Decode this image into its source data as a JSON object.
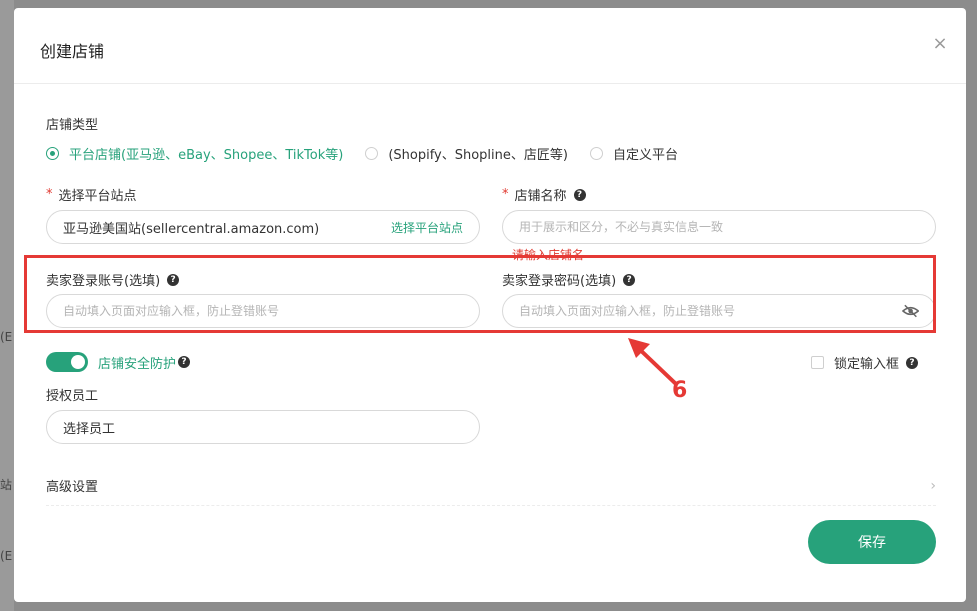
{
  "background": {
    "frag1": "(E",
    "frag2": "站",
    "frag3": "(E"
  },
  "modal": {
    "title": "创建店铺",
    "close": "×"
  },
  "store_type": {
    "label": "店铺类型",
    "options": [
      {
        "label": "平台店铺(亚马逊、eBay、Shopee、TikTok等)",
        "checked": true
      },
      {
        "label": "(Shopify、Shopline、店匠等)",
        "checked": false
      },
      {
        "label": "自定义平台",
        "checked": false
      }
    ]
  },
  "platform_site": {
    "required": "*",
    "label": "选择平台站点",
    "value": "亚马逊美国站(sellercentral.amazon.com)",
    "action": "选择平台站点"
  },
  "store_name": {
    "required": "*",
    "label": "店铺名称",
    "placeholder": "用于展示和区分，不必与真实信息一致",
    "error": "请输入店铺名"
  },
  "seller_account": {
    "label": "卖家登录账号(选填)",
    "placeholder": "自动填入页面对应输入框，防止登错账号"
  },
  "seller_password": {
    "label": "卖家登录密码(选填)",
    "placeholder": "自动填入页面对应输入框，防止登错账号"
  },
  "security": {
    "label": "店铺安全防护"
  },
  "lock_input": {
    "label": "锁定输入框"
  },
  "employees": {
    "label": "授权员工",
    "value": "选择员工"
  },
  "advanced": {
    "label": "高级设置"
  },
  "save": {
    "label": "保存"
  },
  "annotation": {
    "number": "6"
  },
  "colors": {
    "accent": "#27a27b",
    "error": "#e0382f",
    "annotation": "#e53935"
  }
}
